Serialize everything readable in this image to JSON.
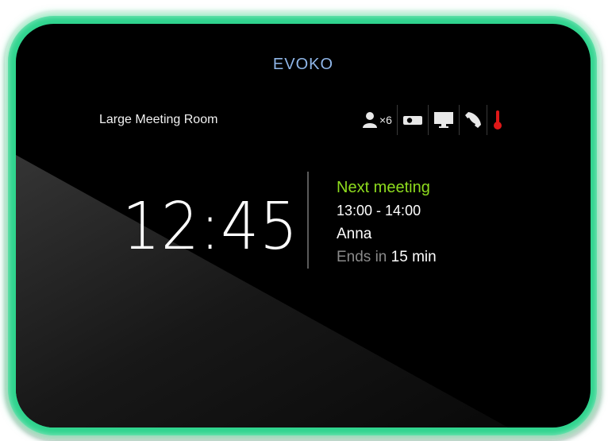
{
  "brand": "EVOKO",
  "room": {
    "name": "Large Meeting Room",
    "capacity": "×6"
  },
  "amenities": [
    {
      "icon": "person-icon",
      "label": "capacity"
    },
    {
      "icon": "projector-icon"
    },
    {
      "icon": "monitor-icon"
    },
    {
      "icon": "phone-icon"
    },
    {
      "icon": "thermometer-icon"
    }
  ],
  "clock": "12:45",
  "next_meeting": {
    "label": "Next meeting",
    "time": "13:00 - 14:00",
    "host": "Anna",
    "ends_prefix": "Ends in",
    "ends_value": "15 min"
  },
  "colors": {
    "led_ring": "#2fd48e",
    "next_label": "#8edc1e",
    "brand": "#8fb6e8",
    "thermometer": "#e01818"
  }
}
